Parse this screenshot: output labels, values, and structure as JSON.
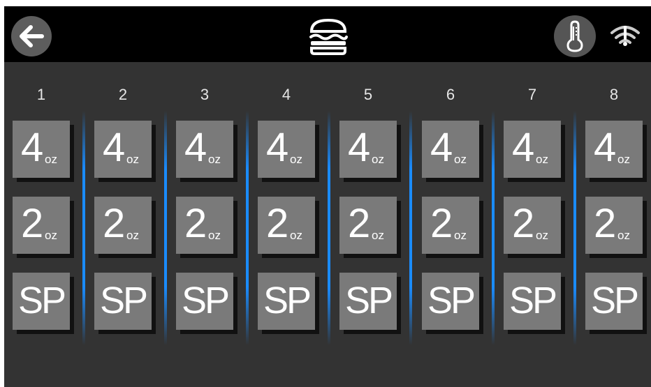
{
  "header": {
    "back_icon": "arrow-left-icon",
    "center_icon": "burger-icon",
    "temperature_icon": "thermometer-icon",
    "wifi_icon": "wifi-alert-icon"
  },
  "colors": {
    "background": "#333333",
    "topbar": "#000000",
    "button": "#7a7a7a",
    "divider": "#1a8cff"
  },
  "lanes": [
    {
      "number": "1",
      "a_value": "4",
      "a_unit": "oz",
      "b_value": "2",
      "b_unit": "oz",
      "special": "SP"
    },
    {
      "number": "2",
      "a_value": "4",
      "a_unit": "oz",
      "b_value": "2",
      "b_unit": "oz",
      "special": "SP"
    },
    {
      "number": "3",
      "a_value": "4",
      "a_unit": "oz",
      "b_value": "2",
      "b_unit": "oz",
      "special": "SP"
    },
    {
      "number": "4",
      "a_value": "4",
      "a_unit": "oz",
      "b_value": "2",
      "b_unit": "oz",
      "special": "SP"
    },
    {
      "number": "5",
      "a_value": "4",
      "a_unit": "oz",
      "b_value": "2",
      "b_unit": "oz",
      "special": "SP"
    },
    {
      "number": "6",
      "a_value": "4",
      "a_unit": "oz",
      "b_value": "2",
      "b_unit": "oz",
      "special": "SP"
    },
    {
      "number": "7",
      "a_value": "4",
      "a_unit": "oz",
      "b_value": "2",
      "b_unit": "oz",
      "special": "SP"
    },
    {
      "number": "8",
      "a_value": "4",
      "a_unit": "oz",
      "b_value": "2",
      "b_unit": "oz",
      "special": "SP"
    }
  ]
}
